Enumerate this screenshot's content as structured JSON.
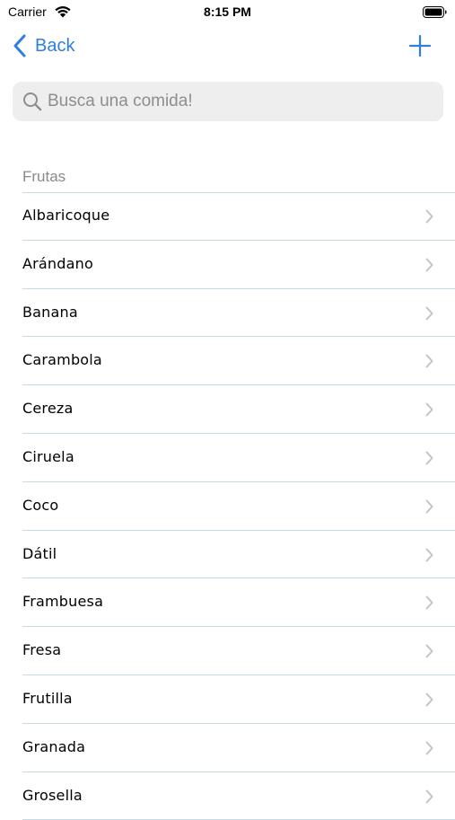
{
  "status_bar": {
    "carrier": "Carrier",
    "time": "8:15 PM"
  },
  "nav": {
    "back_label": "Back",
    "add_icon": "plus-icon"
  },
  "search": {
    "placeholder": "Busca una comida!",
    "value": ""
  },
  "section": {
    "title": "Frutas",
    "items": [
      {
        "label": "Albaricoque"
      },
      {
        "label": "Arándano"
      },
      {
        "label": "Banana"
      },
      {
        "label": "Carambola"
      },
      {
        "label": "Cereza"
      },
      {
        "label": "Ciruela"
      },
      {
        "label": "Coco"
      },
      {
        "label": "Dátil"
      },
      {
        "label": "Frambuesa"
      },
      {
        "label": "Fresa"
      },
      {
        "label": "Frutilla"
      },
      {
        "label": "Granada"
      },
      {
        "label": "Grosella"
      }
    ]
  },
  "colors": {
    "accent": "#2f7ee0",
    "separator": "#c6dbe4",
    "search_bg": "#eeeeef",
    "secondary_text": "#8a8a8e",
    "chevron": "#c4c4c7"
  }
}
